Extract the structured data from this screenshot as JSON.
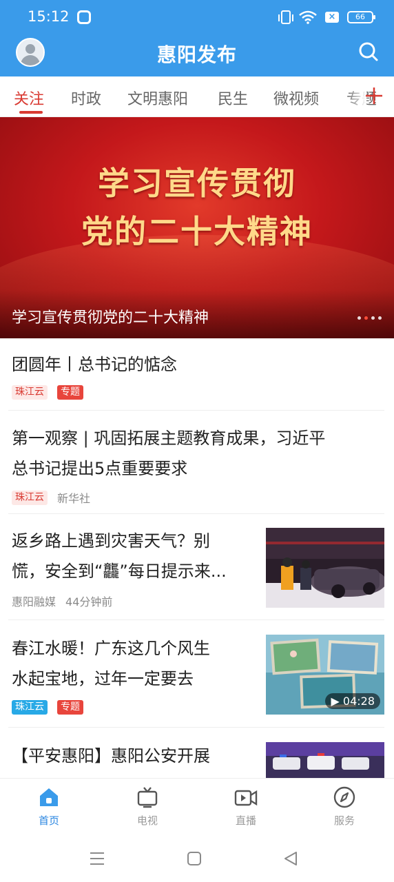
{
  "status_bar": {
    "time": "15:12",
    "battery": "66"
  },
  "header": {
    "title": "惠阳发布",
    "accent_color": "#3a9bea"
  },
  "tabs": [
    {
      "label": "关注",
      "active": true
    },
    {
      "label": "时政",
      "active": false
    },
    {
      "label": "文明惠阳",
      "active": false
    },
    {
      "label": "民生",
      "active": false
    },
    {
      "label": "微视频",
      "active": false
    },
    {
      "label": "专题",
      "active": false
    }
  ],
  "banner": {
    "headline_line1": "学习宣传贯彻",
    "headline_line2": "党的二十大精神",
    "caption": "学习宣传贯彻党的二十大精神",
    "slide_count": 4,
    "active_slide": 2
  },
  "news": [
    {
      "title": "团圆年丨总书记的惦念",
      "source_tag": "珠江云",
      "topic_tag": "专题"
    },
    {
      "title_line1": "第一观察 | 巩固拓展主题教育成果，习近平",
      "title_line2": "总书记提出5点重要要求",
      "source_tag": "珠江云",
      "source": "新华社"
    },
    {
      "title_line1": "返乡路上遇到灾害天气？别",
      "title_line2": "慌，安全到“龘”每日提示来...",
      "source": "惠阳融媒",
      "time": "44分钟前"
    },
    {
      "title_line1": "春江水暖！广东这几个风生",
      "title_line2": "水起宝地，过年一定要去",
      "source_tag": "珠江云",
      "topic_tag": "专题",
      "duration": "04:28"
    },
    {
      "title_line1": "【平安惠阳】惠阳公安开展"
    }
  ],
  "bottom_nav": [
    {
      "label": "首页",
      "icon": "home-icon",
      "active": true
    },
    {
      "label": "电视",
      "icon": "tv-icon",
      "active": false
    },
    {
      "label": "直播",
      "icon": "live-video-icon",
      "active": false
    },
    {
      "label": "服务",
      "icon": "compass-icon",
      "active": false
    }
  ]
}
